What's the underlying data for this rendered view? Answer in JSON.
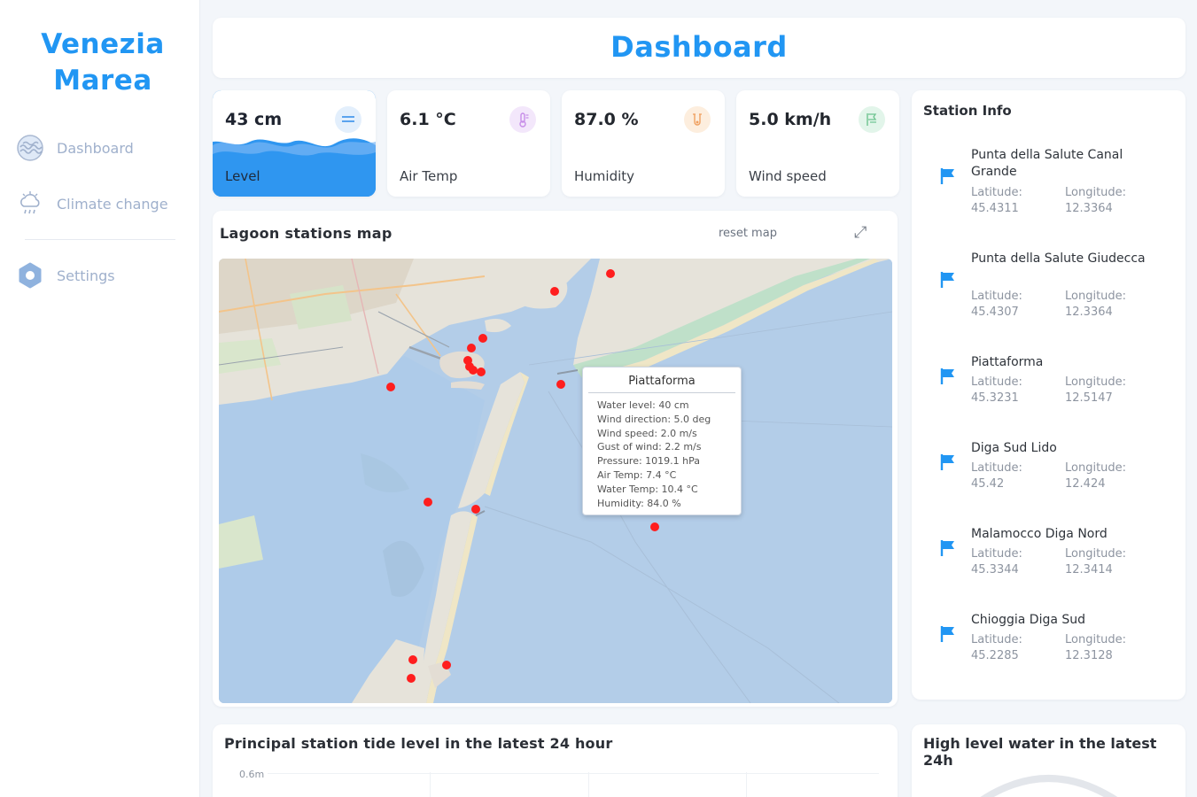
{
  "app": {
    "brand_line1": "Venezia",
    "brand_line2": "Marea"
  },
  "nav": [
    {
      "label": "Dashboard",
      "icon": "wave-icon"
    },
    {
      "label": "Climate change",
      "icon": "cloud-rain-icon"
    },
    {
      "label": "Settings",
      "icon": "gear-icon"
    }
  ],
  "header": {
    "title": "Dashboard"
  },
  "kpis": {
    "level": {
      "value": "43 cm",
      "label": "Level",
      "icon": "equals-icon"
    },
    "air_temp": {
      "value": "6.1 °C",
      "label": "Air Temp",
      "icon": "thermometer-icon"
    },
    "humidity": {
      "value": "87.0 %",
      "label": "Humidity",
      "icon": "humidity-icon"
    },
    "wind": {
      "value": "5.0 km/h",
      "label": "Wind speed",
      "icon": "wind-icon"
    }
  },
  "map_panel": {
    "title": "Lagoon stations map",
    "reset_label": "reset map",
    "expand_icon": "⤢",
    "popup": {
      "title": "Piattaforma",
      "lines": [
        "Water level: 40 cm",
        "Wind direction: 5.0 deg",
        "Wind speed: 2.0 m/s",
        "Gust of wind: 2.2 m/s",
        "Pressure: 1019.1 hPa",
        "Air Temp: 7.4 °C",
        "Water Temp: 10.4 °C",
        "Humidity: 84.0 %"
      ]
    }
  },
  "station_info": {
    "title": "Station Info",
    "stations": [
      {
        "name": "Punta della Salute Canal Grande",
        "lat_label": "Latitude:",
        "lat": "45.4311",
        "lng_label": "Longitude:",
        "lng": "12.3364"
      },
      {
        "name": "Punta della Salute Giudecca",
        "lat_label": "Latitude:",
        "lat": "45.4307",
        "lng_label": "Longitude:",
        "lng": "12.3364"
      },
      {
        "name": "Piattaforma",
        "lat_label": "Latitude:",
        "lat": "45.3231",
        "lng_label": "Longitude:",
        "lng": "12.5147"
      },
      {
        "name": "Diga Sud Lido",
        "lat_label": "Latitude:",
        "lat": "45.42",
        "lng_label": "Longitude:",
        "lng": "12.424"
      },
      {
        "name": "Malamocco Diga Nord",
        "lat_label": "Latitude:",
        "lat": "45.3344",
        "lng_label": "Longitude:",
        "lng": "12.3414"
      },
      {
        "name": "Chioggia Diga Sud",
        "lat_label": "Latitude:",
        "lat": "45.2285",
        "lng_label": "Longitude:",
        "lng": "12.3128"
      }
    ]
  },
  "tide_chart": {
    "title": "Principal station tide level in the latest 24 hour",
    "y_tick": "0.6m"
  },
  "high_water": {
    "title": "High level water in the latest 24h"
  },
  "colors": {
    "accent": "#2196f3",
    "marker": "#ff0000",
    "sea": "#b3cde8"
  }
}
